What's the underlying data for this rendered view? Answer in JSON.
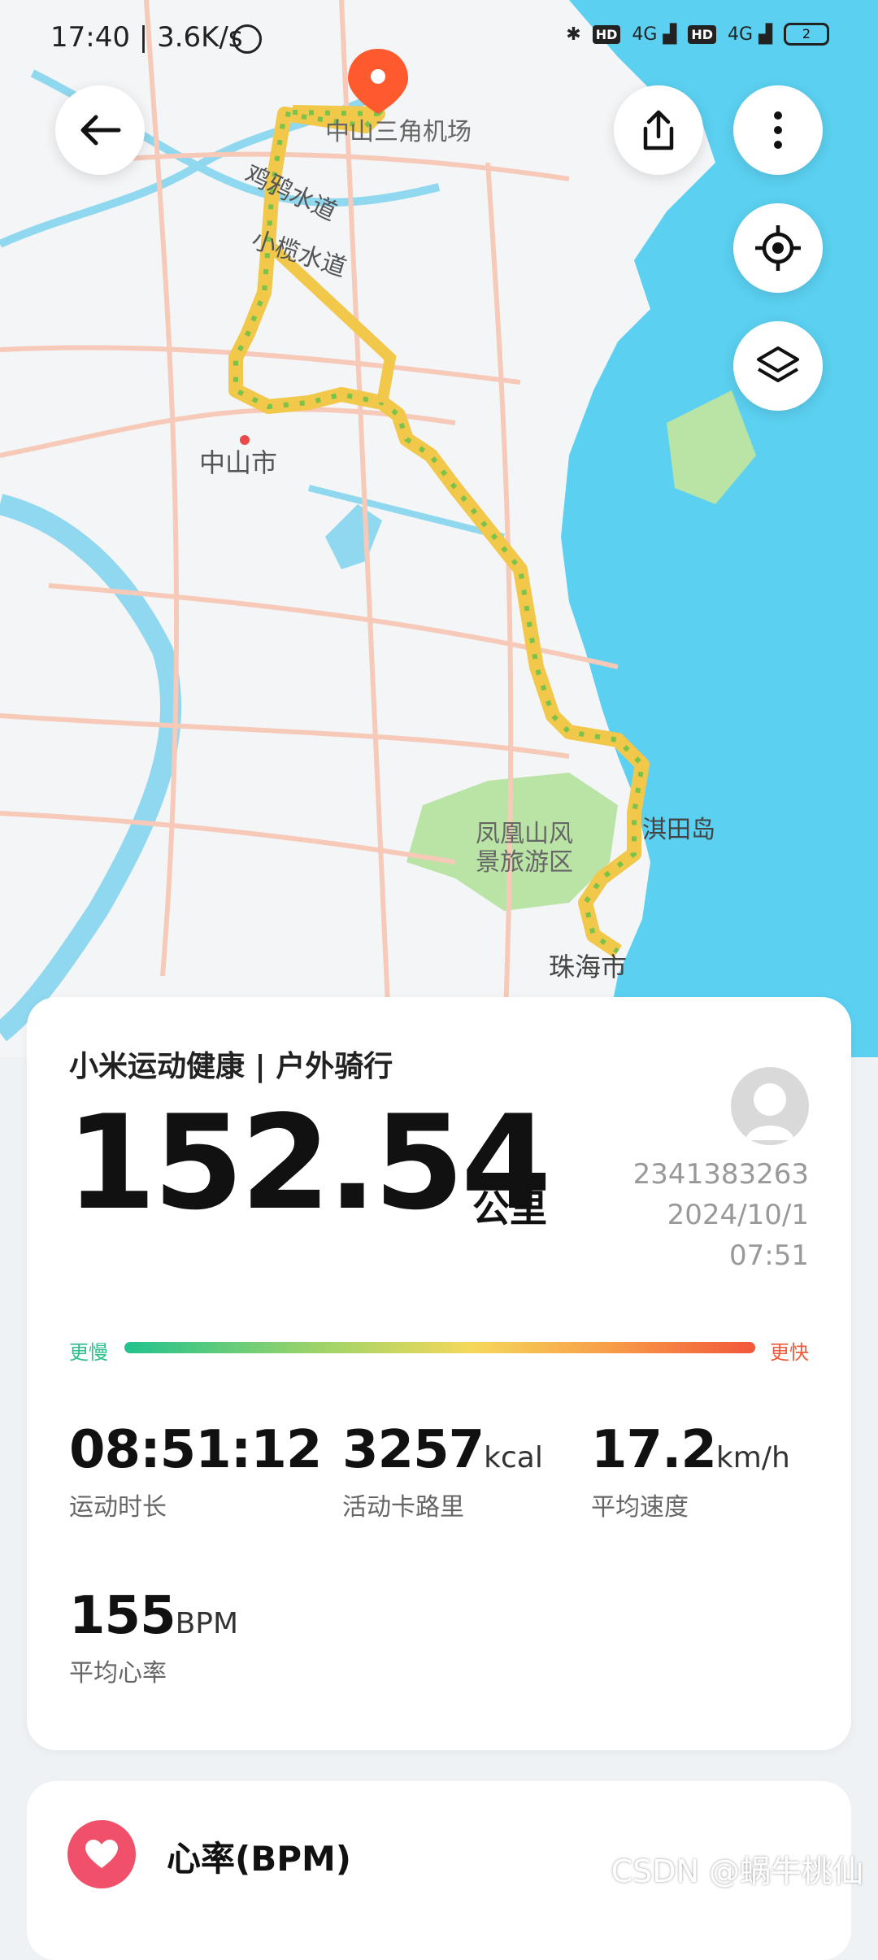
{
  "status_bar": {
    "time": "17:40",
    "net_speed": "3.6K/s",
    "network_labels": [
      "HD",
      "4G",
      "HD",
      "4G"
    ],
    "battery": "2"
  },
  "map": {
    "place_labels": {
      "airport": "中山三角机场",
      "channel1": "鸡鸦水道",
      "channel2": "小榄水道",
      "city1": "中山市",
      "scenic_line1": "凤凰山风",
      "scenic_line2": "景旅游区",
      "island": "淇田岛",
      "city2": "珠海市"
    },
    "colors": {
      "sea": "#5bd0f0",
      "land": "#f3f5f7",
      "river": "#8fd8ef",
      "road": "#f6c9b8",
      "green": "#b9e4a6"
    }
  },
  "top_bar": {
    "back_icon": "arrow-left-icon",
    "share_icon": "share-icon",
    "more_icon": "more-vertical-icon",
    "locate_icon": "locate-icon",
    "layers_icon": "layers-icon"
  },
  "summary": {
    "title": "小米运动健康 | 户外骑行",
    "distance": "152.54",
    "distance_unit": "公里",
    "user_id": "2341383263",
    "date": "2024/10/1",
    "time": "07:51",
    "legend_slow": "更慢",
    "legend_fast": "更快",
    "stats": [
      {
        "value": "08:51:12",
        "unit": "",
        "label": "运动时长"
      },
      {
        "value": "3257",
        "unit": "kcal",
        "label": "活动卡路里"
      },
      {
        "value": "17.2",
        "unit": "km/h",
        "label": "平均速度"
      },
      {
        "value": "155",
        "unit": "BPM",
        "label": "平均心率"
      }
    ]
  },
  "heart_section": {
    "title": "心率(BPM)",
    "icon": "heart-icon"
  },
  "watermark": "CSDN @蜗牛桃仙"
}
